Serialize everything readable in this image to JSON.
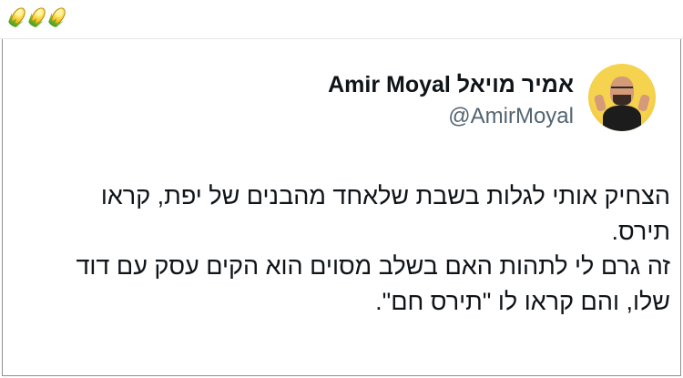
{
  "header": {
    "emoji": [
      {
        "icon": "corn-icon"
      },
      {
        "icon": "corn-icon"
      },
      {
        "icon": "corn-icon"
      }
    ]
  },
  "tweet": {
    "author_name": "אמיר מויאל Amir Moyal",
    "author_handle": "@AmirMoyal",
    "lines": [
      "הצחיק אותי לגלות בשבת שלאחד מהבנים של יפת, קראו",
      "תירס.",
      "זה גרם לי לתהות האם בשלב מסוים הוא הקים עסק עם דוד",
      "שלו, והם קראו לו \"תירס חם\"."
    ]
  },
  "colors": {
    "background": "#ffffff",
    "text": "#0f1419",
    "muted": "#536471",
    "card_border": "#8f8f8f"
  }
}
